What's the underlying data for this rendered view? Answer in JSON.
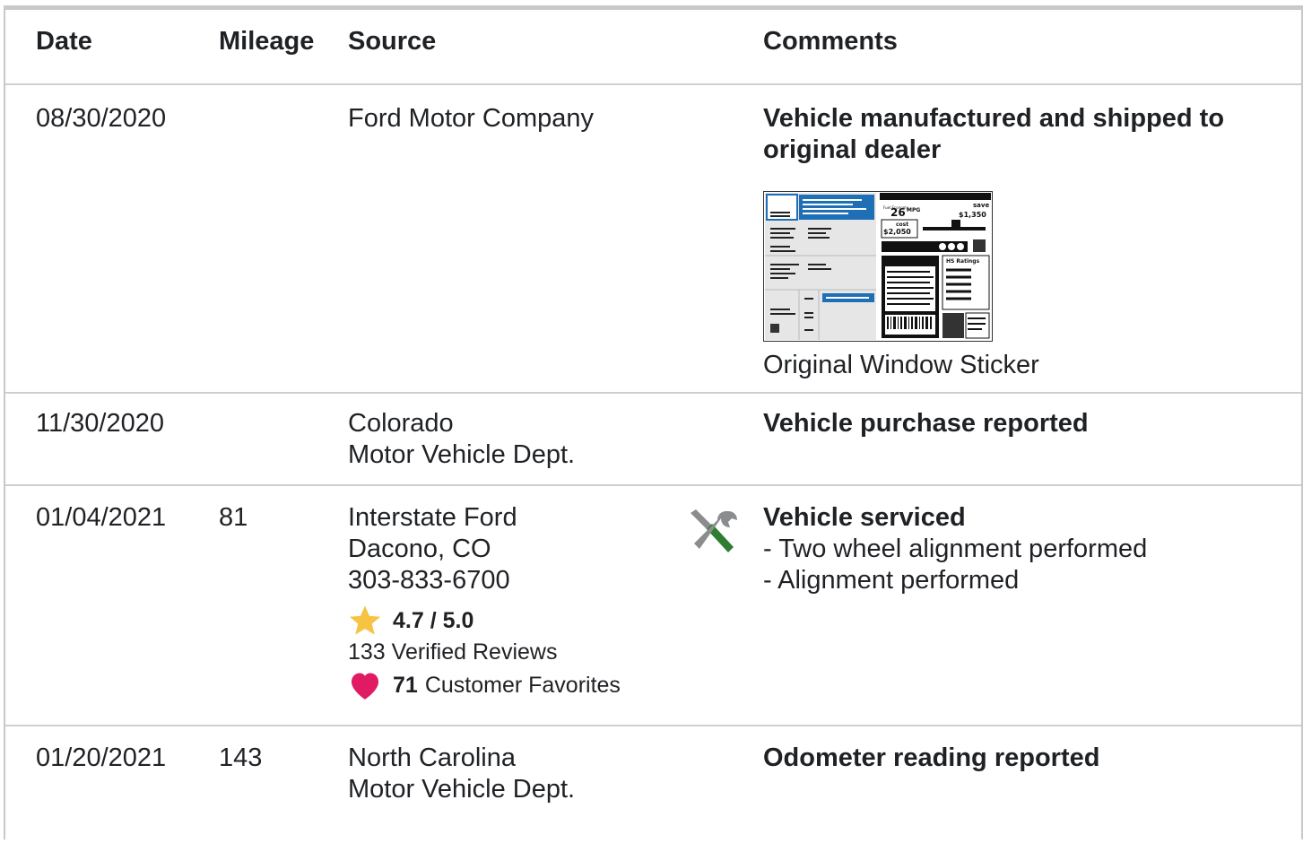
{
  "headers": {
    "date": "Date",
    "mileage": "Mileage",
    "source": "Source",
    "comments": "Comments"
  },
  "rows": [
    {
      "date": "08/30/2020",
      "mileage": "",
      "source": [
        "Ford Motor Company"
      ],
      "comment_title": "Vehicle manufactured and shipped to original dealer",
      "sticker_caption": "Original Window Sticker",
      "sticker": {
        "mpg": "26",
        "mpg_unit": "MPG",
        "save_label": "save",
        "save_value": "$1,350",
        "cost_label": "cost",
        "cost_value": "$2,050",
        "ratings_label": "HS Ratings"
      }
    },
    {
      "date": "11/30/2020",
      "mileage": "",
      "source": [
        "Colorado",
        "Motor Vehicle Dept."
      ],
      "comment_title": "Vehicle purchase reported"
    },
    {
      "date": "01/04/2021",
      "mileage": "81",
      "source": [
        "Interstate Ford",
        "Dacono, CO",
        "303-833-6700"
      ],
      "rating": "4.7 / 5.0",
      "reviews": "133 Verified Reviews",
      "favorites_count": "71",
      "favorites_label": "Customer Favorites",
      "comment_title": "Vehicle serviced",
      "comment_items": [
        "- Two wheel alignment performed",
        "- Alignment performed"
      ],
      "icon": "wrench-screwdriver-icon"
    },
    {
      "date": "01/20/2021",
      "mileage": "143",
      "source": [
        "North Carolina",
        "Motor Vehicle Dept."
      ],
      "comment_title": "Odometer reading reported"
    }
  ],
  "colors": {
    "star": "#f6c342",
    "heart": "#e01b63",
    "wrench_green": "#2e7d32",
    "wrench_gray": "#8a8c8e",
    "sticker_blue": "#1f6fb7"
  }
}
